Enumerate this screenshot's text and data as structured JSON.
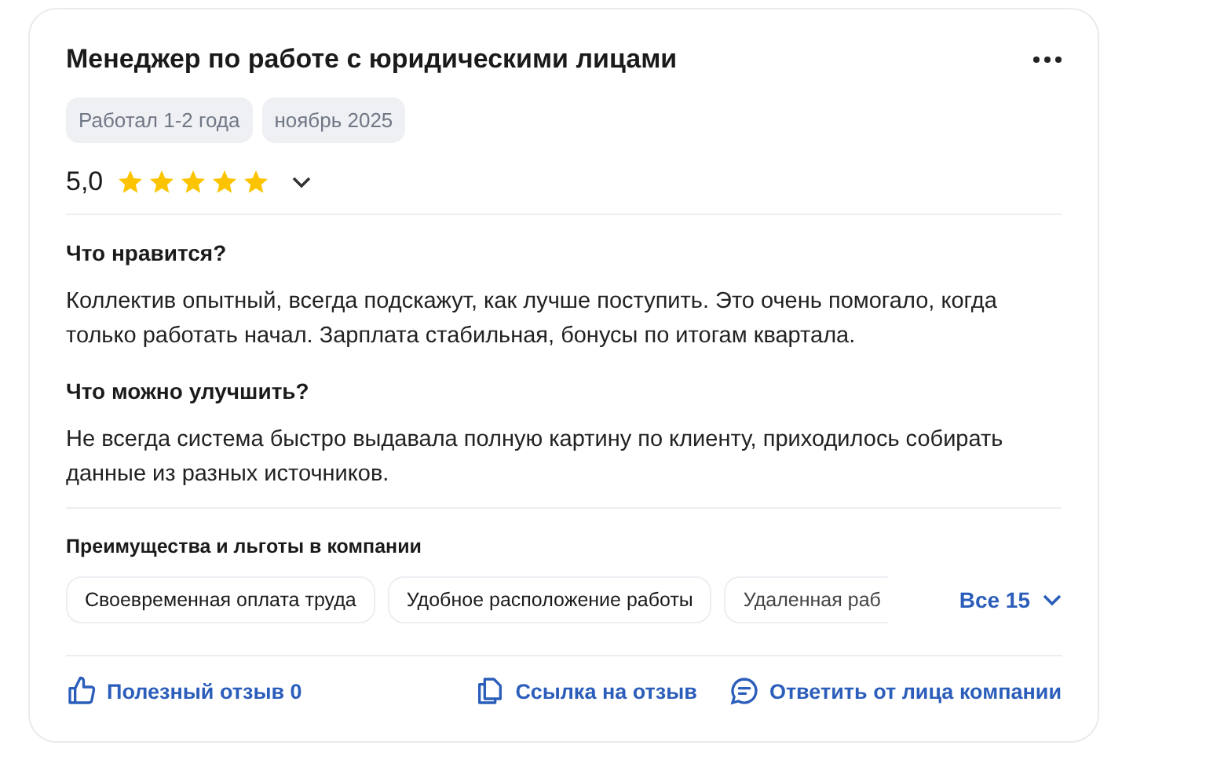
{
  "title": "Менеджер по работе с юридическими лицами",
  "tags": [
    "Работал 1-2 года",
    "ноябрь 2025"
  ],
  "rating": {
    "value": "5,0",
    "stars": 5
  },
  "sections": [
    {
      "heading": "Что нравится?",
      "text": "Коллектив опытный, всегда подскажут, как лучше поступить. Это очень помогало, когда только работать начал. Зарплата стабильная, бонусы по итогам квартала."
    },
    {
      "heading": "Что можно улучшить?",
      "text": "Не всегда система быстро выдавала полную картину по клиенту, приходилось собирать данные из разных источников."
    }
  ],
  "benefits": {
    "heading": "Преимущества и льготы в компании",
    "items": [
      "Своевременная оплата труда",
      "Удобное расположение работы",
      "Удаленная раб"
    ],
    "more": "Все 15"
  },
  "actions": [
    {
      "kind": "like",
      "label": "Полезный отзыв 0"
    },
    {
      "kind": "link",
      "label": "Ссылка на отзыв"
    },
    {
      "kind": "reply",
      "label": "Ответить от лица компании"
    }
  ]
}
